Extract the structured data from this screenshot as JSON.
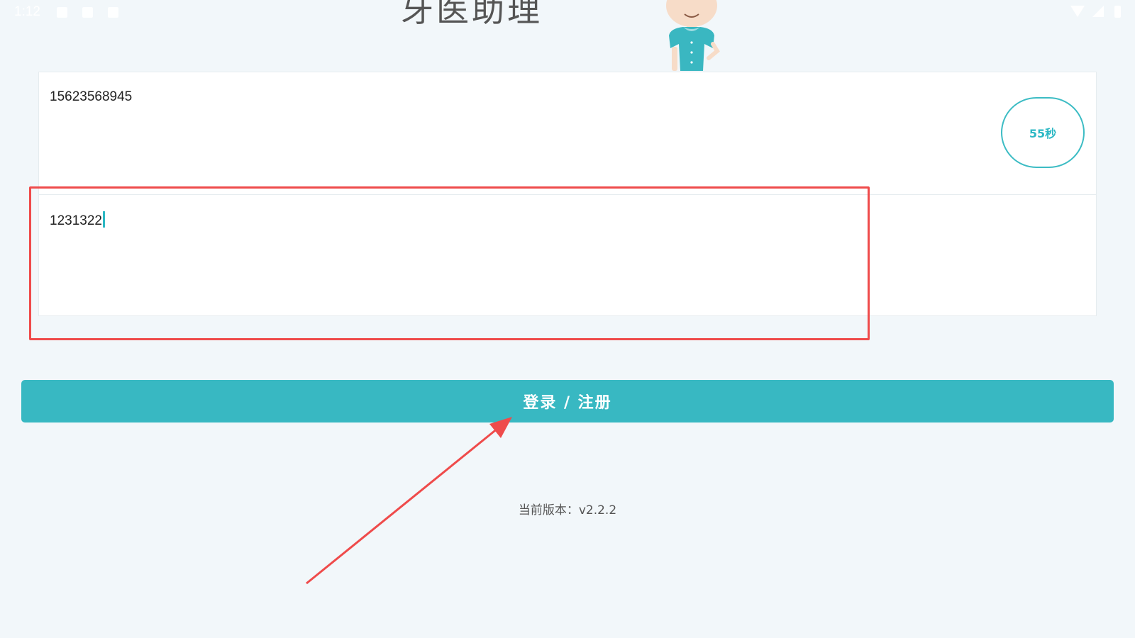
{
  "status_bar": {
    "time": "1:12",
    "icons_left": [
      "image-icon",
      "a-icon",
      "keyboard-icon"
    ],
    "icons_right": [
      "wifi-icon",
      "signal-icon",
      "battery-icon"
    ]
  },
  "header": {
    "app_title": "牙医助理",
    "mascot": "doctor-mascot-illustration"
  },
  "form": {
    "phone_value": "15623568945",
    "code_value": "1231322",
    "countdown_label": "55秒"
  },
  "login_button_label": "登录 / 注册",
  "version_text": "当前版本：v2.2.2",
  "colors": {
    "accent": "#38b8c2",
    "annotation": "#ef4b4b",
    "background": "#f2f7fa"
  }
}
